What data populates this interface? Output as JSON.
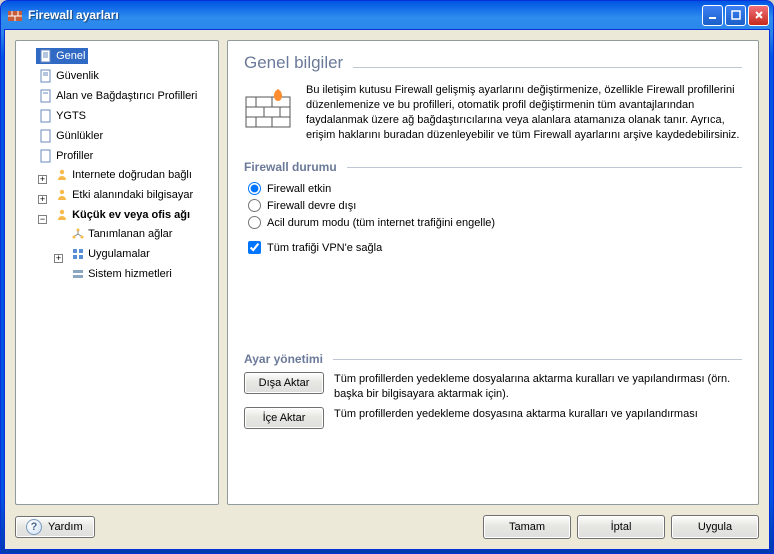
{
  "window_title": "Firewall ayarları",
  "tree": {
    "general": "Genel",
    "security": "Güvenlik",
    "adapter_profiles": "Alan ve Bağdaştırıcı Profilleri",
    "ygts": "YGTS",
    "logs": "Günlükler",
    "profiles": "Profiller",
    "profile_direct": "Internete doğrudan bağlı",
    "profile_domain": "Etki alanındaki bilgisayar",
    "profile_soho": "Küçük ev veya ofis ağı",
    "soho_defined": "Tanımlanan ağlar",
    "soho_apps": "Uygulamalar",
    "soho_services": "Sistem hizmetleri"
  },
  "content": {
    "heading": "Genel bilgiler",
    "intro": "Bu iletişim kutusu Firewall gelişmiş ayarlarını değiştirmenize, özellikle Firewall profillerini düzenlemenize ve bu profilleri, otomatik profil değiştirmenin tüm avantajlarından faydalanmak üzere ağ bağdaştırıcılarına veya alanlara atamanıza olanak tanır. Ayrıca, erişim haklarını buradan düzenleyebilir ve tüm Firewall ayarlarını arşive kaydedebilirsiniz.",
    "status_heading": "Firewall durumu",
    "radio_enabled": "Firewall etkin",
    "radio_disabled": "Firewall devre dışı",
    "radio_emergency": "Acil durum modu (tüm internet trafiğini engelle)",
    "vpn_check": "Tüm trafiği VPN'e sağla",
    "mgmt_heading": "Ayar yönetimi",
    "export_btn": "Dışa Aktar",
    "export_desc": "Tüm profillerden yedekleme dosyalarına aktarma kuralları ve yapılandırması (örn. başka bir bilgisayara aktarmak için).",
    "import_btn": "İçe Aktar",
    "import_desc": "Tüm profillerden yedekleme dosyasına aktarma kuralları ve yapılandırması"
  },
  "footer": {
    "help": "Yardım",
    "ok": "Tamam",
    "cancel": "İptal",
    "apply": "Uygula"
  }
}
